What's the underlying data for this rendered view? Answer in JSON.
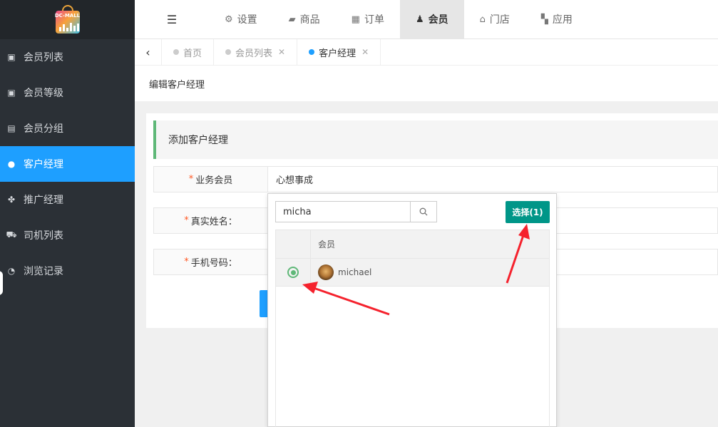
{
  "logo": {
    "text": "DC-MALL"
  },
  "sidebar": {
    "items": [
      {
        "label": "会员列表",
        "icon": "address-book-icon",
        "glyph": "▣",
        "active": false
      },
      {
        "label": "会员等级",
        "icon": "address-book-icon",
        "glyph": "▣",
        "active": false
      },
      {
        "label": "会员分组",
        "icon": "id-card-icon",
        "glyph": "▤",
        "active": false
      },
      {
        "label": "客户经理",
        "icon": "user-circle-icon",
        "glyph": "●",
        "active": true
      },
      {
        "label": "推广经理",
        "icon": "users-icon",
        "glyph": "✤",
        "active": false
      },
      {
        "label": "司机列表",
        "icon": "car-icon",
        "glyph": "⛟",
        "active": false
      },
      {
        "label": "浏览记录",
        "icon": "clock-icon",
        "glyph": "◔",
        "active": false
      }
    ]
  },
  "topnav": {
    "items": [
      {
        "label": "设置",
        "icon": "cogs-icon",
        "glyph": "⚙",
        "active": false
      },
      {
        "label": "商品",
        "icon": "shopping-bag-icon",
        "glyph": "▰",
        "active": false
      },
      {
        "label": "订单",
        "icon": "table-icon",
        "glyph": "▦",
        "active": false
      },
      {
        "label": "会员",
        "icon": "user-icon",
        "glyph": "♟",
        "active": true
      },
      {
        "label": "门店",
        "icon": "bank-icon",
        "glyph": "⌂",
        "active": false
      },
      {
        "label": "应用",
        "icon": "grid-icon",
        "glyph": "▚",
        "active": false
      }
    ]
  },
  "tabs": [
    {
      "label": "首页",
      "closable": false,
      "active": false
    },
    {
      "label": "会员列表",
      "closable": true,
      "active": false
    },
    {
      "label": "客户经理",
      "closable": true,
      "active": true
    }
  ],
  "breadcrumb": {
    "title": "编辑客户经理"
  },
  "form": {
    "header": "添加客户经理",
    "fields": [
      {
        "label": "业务会员",
        "value": "心想事成"
      },
      {
        "label": "真实姓名：",
        "value": ""
      },
      {
        "label": "手机号码：",
        "value": ""
      }
    ],
    "required_mark": "*"
  },
  "popup": {
    "search_value": "micha",
    "select_button": "选择(1)",
    "column_header": "会员",
    "rows": [
      {
        "name": "michael",
        "selected": true
      }
    ]
  },
  "colors": {
    "sidebar_bg": "#2b3036",
    "active_blue": "#1e9fff",
    "select_green": "#009688",
    "radio_green": "#5fb878",
    "arrow_red": "#f5222d"
  }
}
